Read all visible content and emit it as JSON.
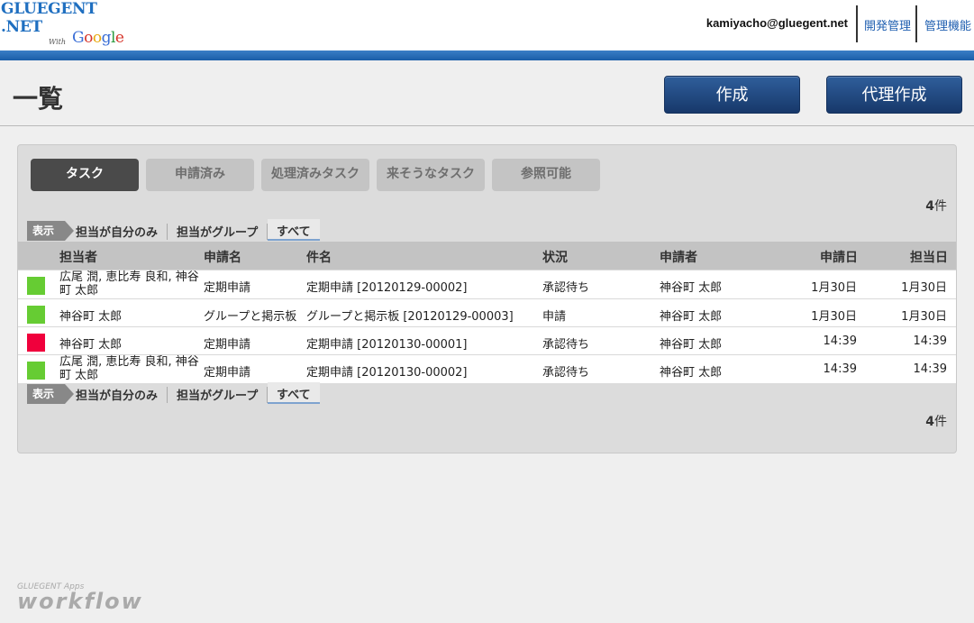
{
  "header": {
    "logo_line1": "GLUEGENT",
    "logo_line2": ".NET",
    "logo_with": "With",
    "logo_google": "Google",
    "user_email": "kamiyacho@gluegent.net",
    "links": [
      "開発管理",
      "管理機能"
    ]
  },
  "page": {
    "title": "一覧",
    "create_button": "作成",
    "proxy_create_button": "代理作成"
  },
  "tabs": [
    "タスク",
    "申請済み",
    "処理済みタスク",
    "来そうなタスク",
    "参照可能"
  ],
  "count": {
    "number": "4",
    "unit": "件"
  },
  "filter": {
    "label": "表示",
    "options": [
      "担当が自分のみ",
      "担当がグループ",
      "すべて"
    ]
  },
  "table": {
    "headers": [
      "担当者",
      "申請名",
      "件名",
      "状況",
      "申請者",
      "申請日",
      "担当日"
    ],
    "rows": [
      {
        "status_color": "#66cc33",
        "assignee": "広尾 潤, 恵比寿 良和, 神谷町 太郎",
        "app_name": "定期申請",
        "subject": "定期申請 [20120129-00002]",
        "state": "承認待ち",
        "applicant": "神谷町 太郎",
        "applied": "1月30日",
        "assigned": "1月30日"
      },
      {
        "status_color": "#66cc33",
        "assignee": "神谷町 太郎",
        "app_name": "グループと掲示板",
        "subject": "グループと掲示板 [20120129-00003]",
        "state": "申請",
        "applicant": "神谷町 太郎",
        "applied": "1月30日",
        "assigned": "1月30日"
      },
      {
        "status_color": "#f0003c",
        "assignee": "神谷町 太郎",
        "app_name": "定期申請",
        "subject": "定期申請 [20120130-00001]",
        "state": "承認待ち",
        "applicant": "神谷町 太郎",
        "applied": "14:39",
        "assigned": "14:39"
      },
      {
        "status_color": "#66cc33",
        "assignee": "広尾 潤, 恵比寿 良和, 神谷町 太郎",
        "app_name": "定期申請",
        "subject": "定期申請 [20120130-00002]",
        "state": "承認待ち",
        "applicant": "神谷町 太郎",
        "applied": "14:39",
        "assigned": "14:39"
      }
    ]
  },
  "footer": {
    "small": "GLUEGENT Apps",
    "big": "workflow"
  }
}
